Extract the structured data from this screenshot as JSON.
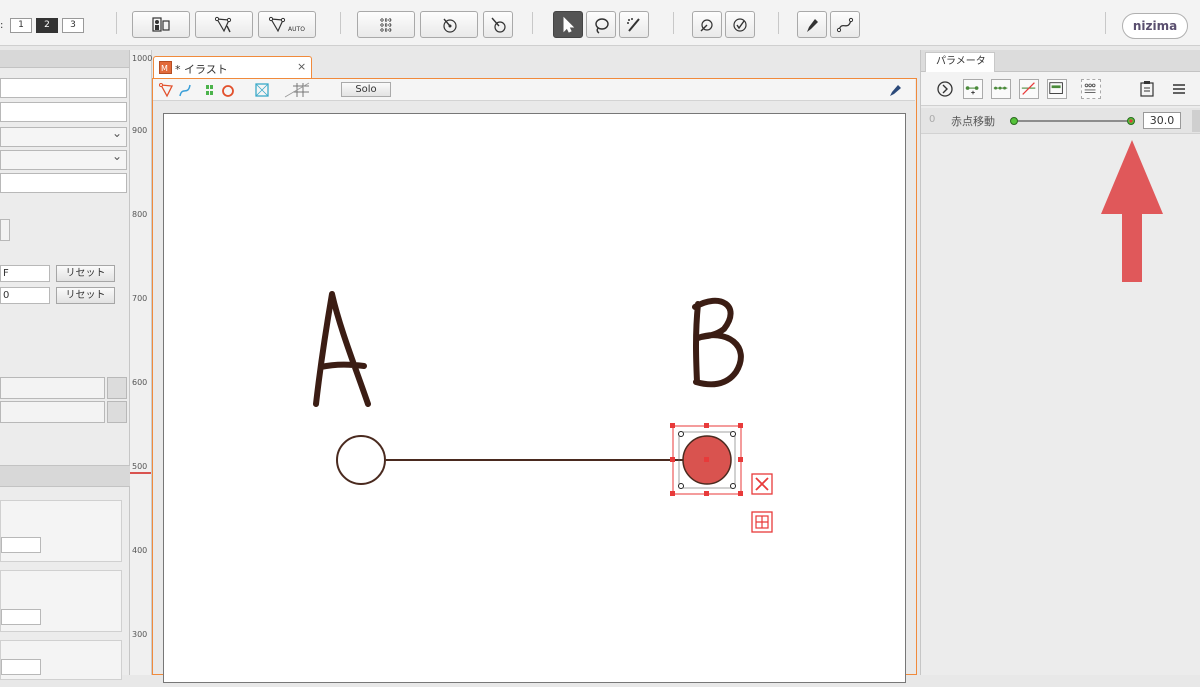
{
  "toolbar": {
    "pages": [
      "1",
      "2",
      "3"
    ],
    "selected_page": "2",
    "auto_label": "AUTO",
    "logo": "nizima"
  },
  "left_panel": {
    "reset_label_1": "リセット",
    "reset_label_2": "リセット",
    "value_1": "F",
    "value_2": "0"
  },
  "ruler": {
    "labels": [
      "1000",
      "900",
      "800",
      "700",
      "600",
      "500",
      "400",
      "300"
    ]
  },
  "document": {
    "tab_title": "* イラスト",
    "tab_close": "×",
    "solo_label": "Solo"
  },
  "canvas": {
    "label_a": "A",
    "label_b": "B",
    "accent_color": "#d9534f",
    "line_color": "#4a2a1f"
  },
  "parameter_panel": {
    "tab_label": "パラメータ",
    "params": [
      {
        "index": "0",
        "name": "赤点移動",
        "value": "30.0"
      }
    ]
  }
}
